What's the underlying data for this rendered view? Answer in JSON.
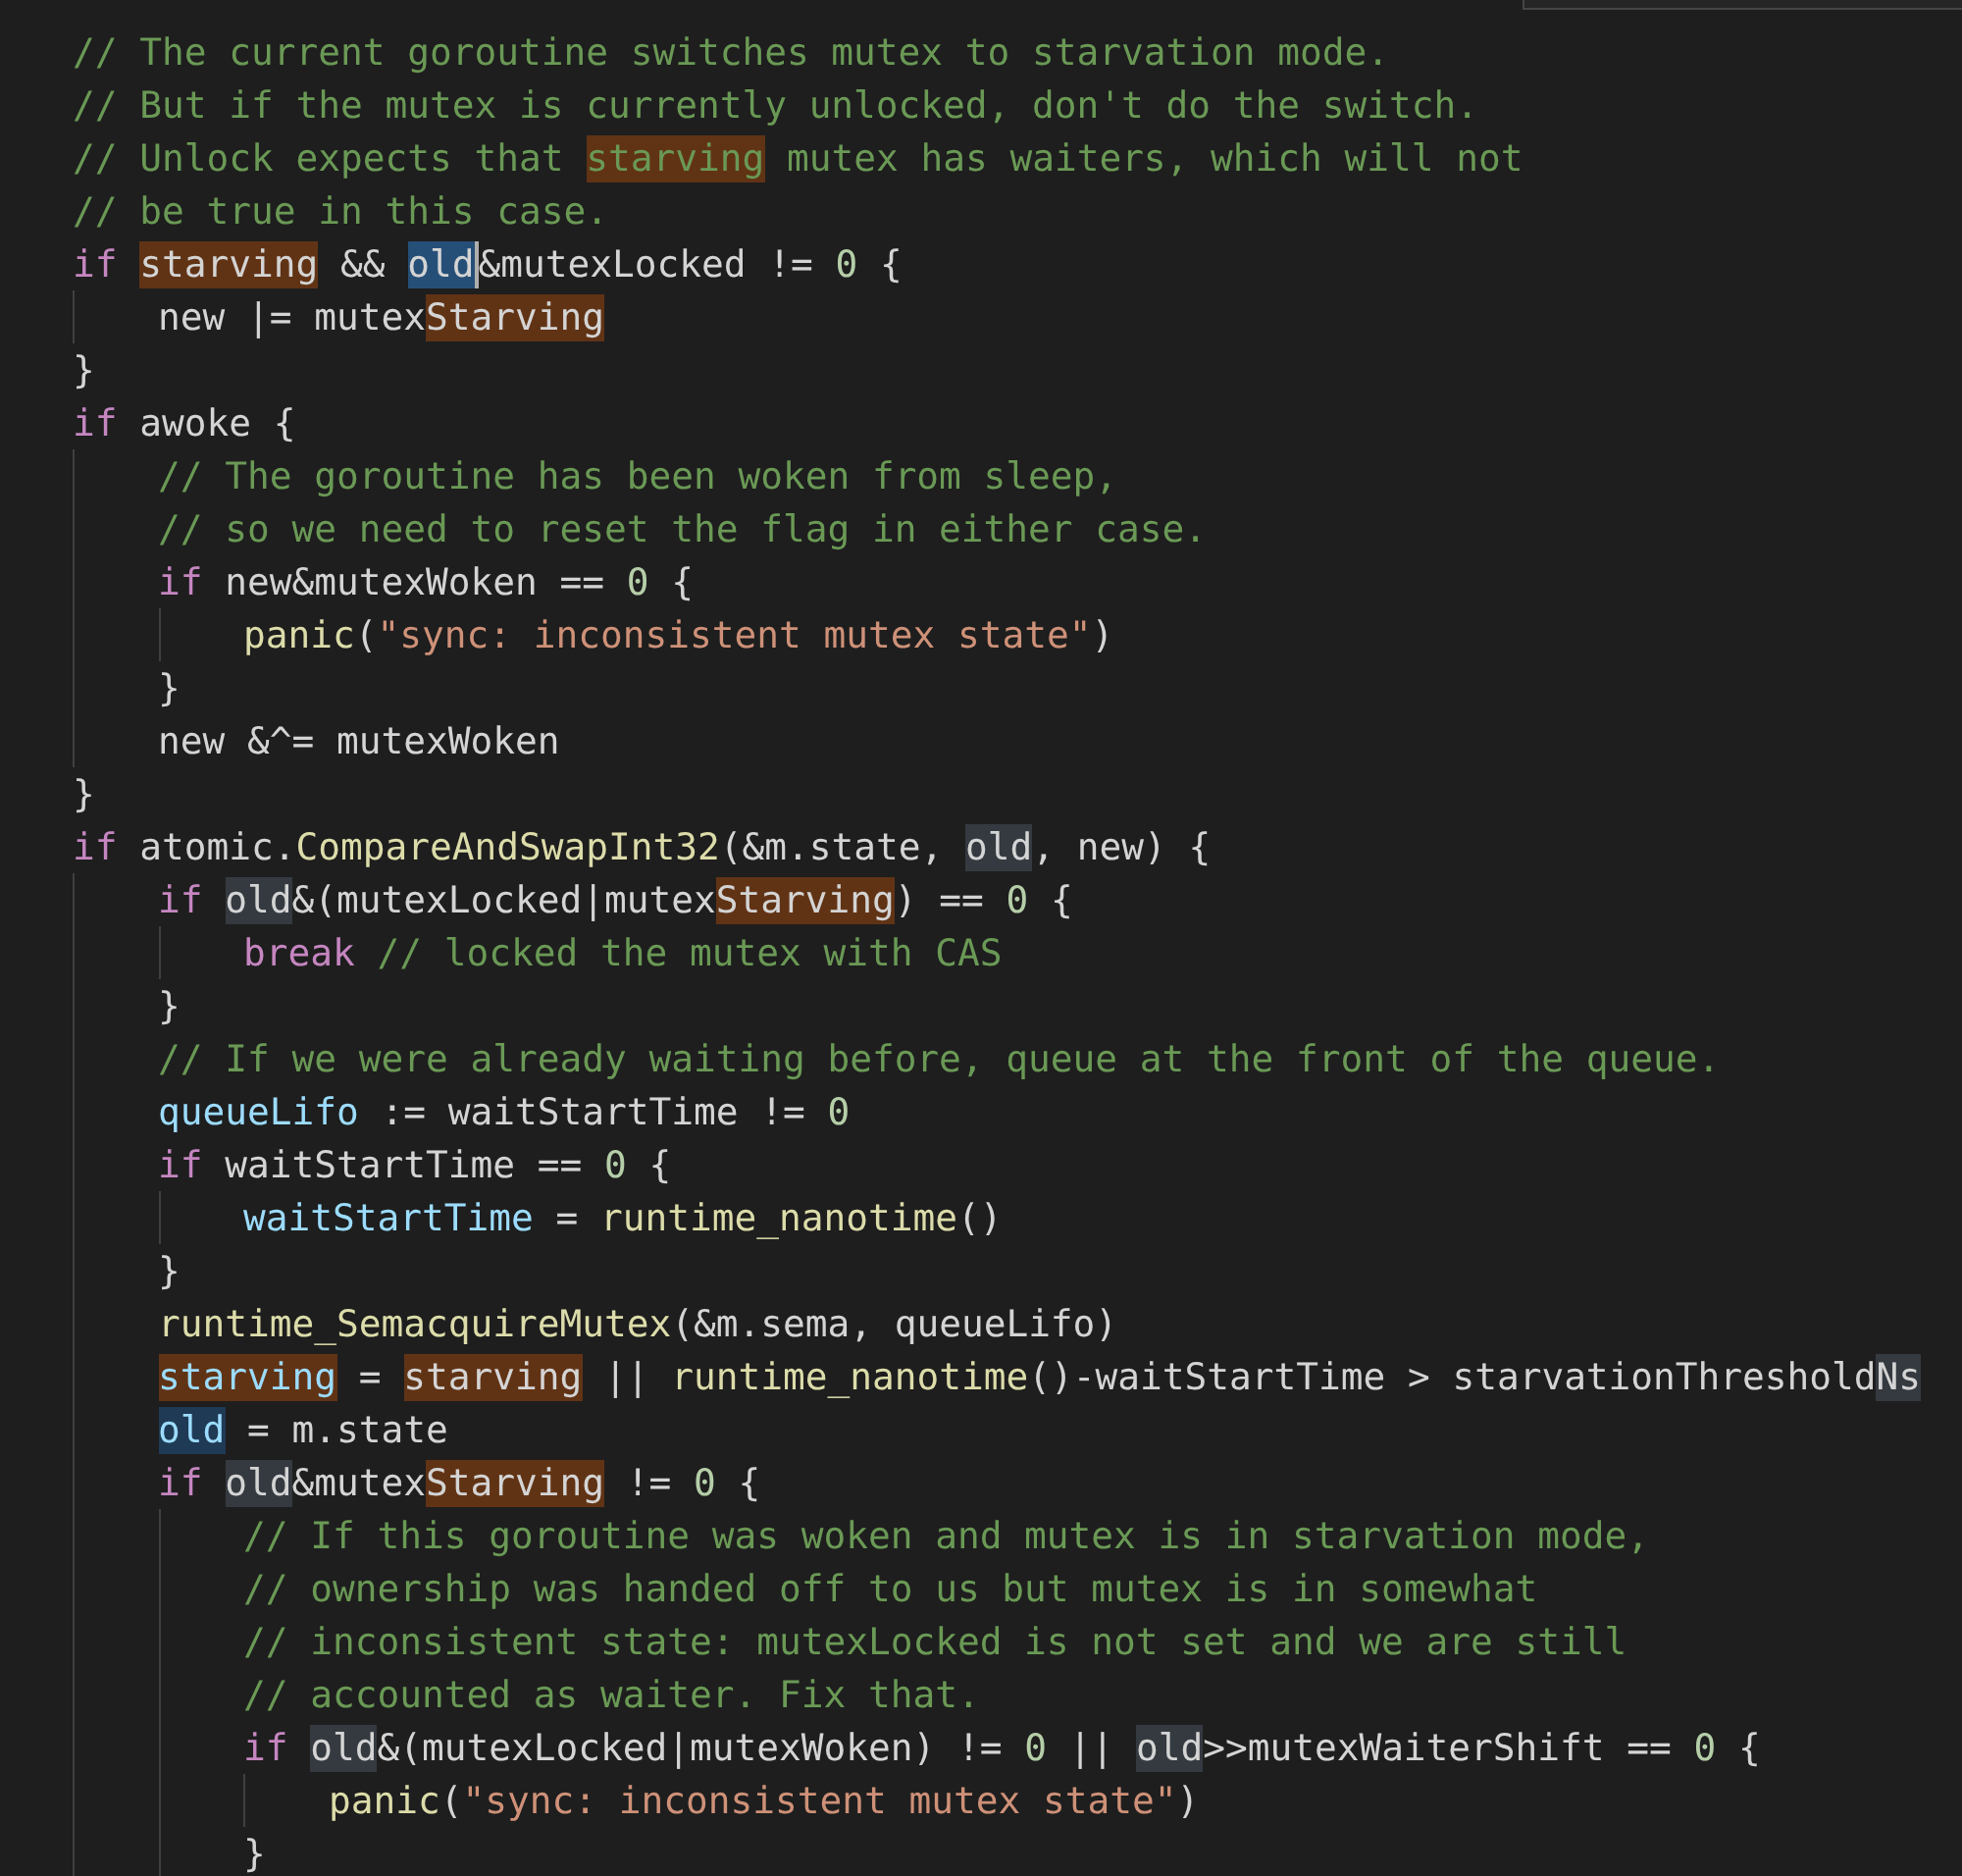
{
  "editor": {
    "overlay_panel": true,
    "lines": [
      {
        "tokens": [
          {
            "t": "// The current goroutine switches mutex to starvation mode.",
            "kind": "comment"
          }
        ]
      },
      {
        "tokens": [
          {
            "t": "// But if the mutex is currently unlocked, don't do the switch.",
            "kind": "comment"
          }
        ]
      },
      {
        "tokens": [
          {
            "t": "// Unlock expects that ",
            "kind": "comment"
          },
          {
            "t": "starving",
            "kind": "comment",
            "search_match": true
          },
          {
            "t": " mutex has waiters, which will not",
            "kind": "comment"
          }
        ]
      },
      {
        "tokens": [
          {
            "t": "// be true in this case.",
            "kind": "comment"
          }
        ]
      },
      {
        "tokens": [
          {
            "t": "if ",
            "kind": "keyword"
          },
          {
            "t": "starving",
            "kind": "plain",
            "search_match": true
          },
          {
            "t": " && ",
            "kind": "plain"
          },
          {
            "t": "old",
            "kind": "plain",
            "selected_text": true,
            "caret": true
          },
          {
            "t": "&mutexLocked != ",
            "kind": "plain"
          },
          {
            "t": "0",
            "kind": "number"
          },
          {
            "t": " {",
            "kind": "plain"
          }
        ],
        "children": [
          {
            "tokens": [
              {
                "t": "new |= mutex",
                "kind": "plain"
              },
              {
                "t": "Starving",
                "kind": "plain",
                "search_match": true
              }
            ]
          }
        ]
      },
      {
        "tokens": [
          {
            "t": "}",
            "kind": "plain"
          }
        ]
      },
      {
        "tokens": [
          {
            "t": "if",
            "kind": "keyword"
          },
          {
            "t": " awoke {",
            "kind": "plain"
          }
        ],
        "children": [
          {
            "tokens": [
              {
                "t": "// The goroutine has been woken from sleep,",
                "kind": "comment"
              }
            ]
          },
          {
            "tokens": [
              {
                "t": "// so we need to reset the flag in either case.",
                "kind": "comment"
              }
            ]
          },
          {
            "tokens": [
              {
                "t": "if",
                "kind": "keyword"
              },
              {
                "t": " new&mutexWoken == ",
                "kind": "plain"
              },
              {
                "t": "0",
                "kind": "number"
              },
              {
                "t": " {",
                "kind": "plain"
              }
            ],
            "children": [
              {
                "tokens": [
                  {
                    "t": "panic",
                    "kind": "function"
                  },
                  {
                    "t": "(",
                    "kind": "plain"
                  },
                  {
                    "t": "\"sync: inconsistent mutex state\"",
                    "kind": "string"
                  },
                  {
                    "t": ")",
                    "kind": "plain"
                  }
                ]
              }
            ]
          },
          {
            "tokens": [
              {
                "t": "}",
                "kind": "plain"
              }
            ]
          },
          {
            "tokens": [
              {
                "t": "new &^= mutexWoken",
                "kind": "plain"
              }
            ]
          }
        ]
      },
      {
        "tokens": [
          {
            "t": "}",
            "kind": "plain"
          }
        ]
      },
      {
        "tokens": [
          {
            "t": "if",
            "kind": "keyword"
          },
          {
            "t": " atomic.",
            "kind": "plain"
          },
          {
            "t": "CompareAndSwapInt32",
            "kind": "function"
          },
          {
            "t": "(&m.state, ",
            "kind": "plain"
          },
          {
            "t": "old",
            "kind": "plain",
            "occurrence": true
          },
          {
            "t": ", new) {",
            "kind": "plain"
          }
        ],
        "children": [
          {
            "tokens": [
              {
                "t": "if ",
                "kind": "keyword"
              },
              {
                "t": "old",
                "kind": "plain",
                "occurrence": true
              },
              {
                "t": "&(mutexLocked|mutex",
                "kind": "plain"
              },
              {
                "t": "Starving",
                "kind": "plain",
                "search_match": true
              },
              {
                "t": ") == ",
                "kind": "plain"
              },
              {
                "t": "0",
                "kind": "number"
              },
              {
                "t": " {",
                "kind": "plain"
              }
            ],
            "children": [
              {
                "tokens": [
                  {
                    "t": "break",
                    "kind": "keyword"
                  },
                  {
                    "t": " // locked the mutex with CAS",
                    "kind": "comment"
                  }
                ]
              }
            ]
          },
          {
            "tokens": [
              {
                "t": "}",
                "kind": "plain"
              }
            ]
          },
          {
            "tokens": [
              {
                "t": "// If we were already waiting before, queue at the front of the queue.",
                "kind": "comment"
              }
            ]
          },
          {
            "tokens": [
              {
                "t": "queueLifo",
                "kind": "variable"
              },
              {
                "t": " := waitStartTime != ",
                "kind": "plain"
              },
              {
                "t": "0",
                "kind": "number"
              }
            ]
          },
          {
            "tokens": [
              {
                "t": "if",
                "kind": "keyword"
              },
              {
                "t": " waitStartTime == ",
                "kind": "plain"
              },
              {
                "t": "0",
                "kind": "number"
              },
              {
                "t": " {",
                "kind": "plain"
              }
            ],
            "children": [
              {
                "tokens": [
                  {
                    "t": "waitStartTime",
                    "kind": "variable"
                  },
                  {
                    "t": " = ",
                    "kind": "plain"
                  },
                  {
                    "t": "runtime_nanotime",
                    "kind": "function"
                  },
                  {
                    "t": "()",
                    "kind": "plain"
                  }
                ]
              }
            ]
          },
          {
            "tokens": [
              {
                "t": "}",
                "kind": "plain"
              }
            ]
          },
          {
            "tokens": [
              {
                "t": "runtime_SemacquireMutex",
                "kind": "function"
              },
              {
                "t": "(&m.sema, queueLifo)",
                "kind": "plain"
              }
            ]
          },
          {
            "tokens": [
              {
                "t": "starving",
                "kind": "variable",
                "search_match": true
              },
              {
                "t": " = ",
                "kind": "plain"
              },
              {
                "t": "starving",
                "kind": "plain",
                "search_match": true
              },
              {
                "t": " || ",
                "kind": "plain"
              },
              {
                "t": "runtime_nanotime",
                "kind": "function"
              },
              {
                "t": "()-waitStartTime > starvationThreshold",
                "kind": "plain"
              },
              {
                "t": "Ns",
                "kind": "plain",
                "occurrence": true
              }
            ]
          },
          {
            "tokens": [
              {
                "t": "old",
                "kind": "variable",
                "write_occurrence": true
              },
              {
                "t": " = m.state",
                "kind": "plain"
              }
            ]
          },
          {
            "tokens": [
              {
                "t": "if ",
                "kind": "keyword"
              },
              {
                "t": "old",
                "kind": "plain",
                "occurrence": true
              },
              {
                "t": "&mutex",
                "kind": "plain"
              },
              {
                "t": "Starving",
                "kind": "plain",
                "search_match": true
              },
              {
                "t": " != ",
                "kind": "plain"
              },
              {
                "t": "0",
                "kind": "number"
              },
              {
                "t": " {",
                "kind": "plain"
              }
            ],
            "children": [
              {
                "tokens": [
                  {
                    "t": "// If this goroutine was woken and mutex is in starvation mode,",
                    "kind": "comment"
                  }
                ]
              },
              {
                "tokens": [
                  {
                    "t": "// ownership was handed off to us but mutex is in somewhat",
                    "kind": "comment"
                  }
                ]
              },
              {
                "tokens": [
                  {
                    "t": "// inconsistent state: mutexLocked is not set and we are still",
                    "kind": "comment"
                  }
                ]
              },
              {
                "tokens": [
                  {
                    "t": "// accounted as waiter. Fix that.",
                    "kind": "comment"
                  }
                ]
              },
              {
                "tokens": [
                  {
                    "t": "if ",
                    "kind": "keyword"
                  },
                  {
                    "t": "old",
                    "kind": "plain",
                    "occurrence": true
                  },
                  {
                    "t": "&(mutexLocked|mutexWoken) != ",
                    "kind": "plain"
                  },
                  {
                    "t": "0",
                    "kind": "number"
                  },
                  {
                    "t": " || ",
                    "kind": "plain"
                  },
                  {
                    "t": "old",
                    "kind": "plain",
                    "occurrence": true
                  },
                  {
                    "t": ">>mutexWaiterShift == ",
                    "kind": "plain"
                  },
                  {
                    "t": "0",
                    "kind": "number"
                  },
                  {
                    "t": " {",
                    "kind": "plain"
                  }
                ],
                "children": [
                  {
                    "tokens": [
                      {
                        "t": "panic",
                        "kind": "function"
                      },
                      {
                        "t": "(",
                        "kind": "plain"
                      },
                      {
                        "t": "\"sync: inconsistent mutex state\"",
                        "kind": "string"
                      },
                      {
                        "t": ")",
                        "kind": "plain"
                      }
                    ]
                  }
                ]
              },
              {
                "tokens": [
                  {
                    "t": "}",
                    "kind": "plain"
                  }
                ]
              }
            ]
          }
        ]
      }
    ]
  }
}
